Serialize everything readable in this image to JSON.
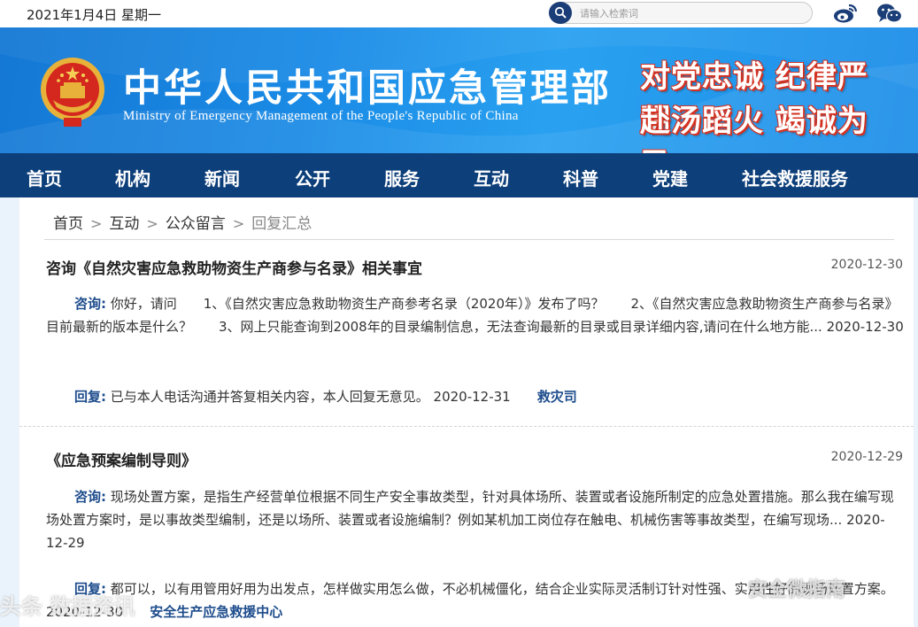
{
  "topbar": {
    "date": "2021年1月4日 星期一",
    "search_placeholder": "请输入检索词",
    "icons": [
      "search-icon",
      "weibo-icon",
      "wechat-icon"
    ]
  },
  "header": {
    "title_cn": "中华人民共和国应急管理部",
    "title_en": "Ministry of Emergency Management of the People's Republic of China",
    "slogan_line1": "对党忠诚 纪律严明",
    "slogan_line2": "赴汤蹈火 竭诚为民"
  },
  "nav": {
    "items": [
      "首页",
      "机构",
      "新闻",
      "公开",
      "服务",
      "互动",
      "科普",
      "党建",
      "社会救援服务"
    ]
  },
  "breadcrumb": {
    "home": "首页",
    "interact": "互动",
    "messages": "公众留言",
    "current": "回复汇总",
    "sep": ">"
  },
  "items": [
    {
      "title": "咨询《自然灾害应急救助物资生产商参与名录》相关事宜",
      "date": "2020-12-30",
      "ask_label": "咨询:",
      "ask_text": " 你好，请问　　1、《自然灾害应急救助物资生产商参考名录（2020年）》发布了吗？　　2、《自然灾害应急救助物资生产商参与名录》目前最新的版本是什么？　　3、网上只能查询到2008年的目录编制信息，无法查询最新的目录或目录详细内容,请问在什么地方能... 2020-12-30",
      "reply_label": "回复:",
      "reply_text": " 已与本人电话沟通并答复相关内容，本人回复无意见。 2020-12-31",
      "reply_dept": "救灾司"
    },
    {
      "title": "《应急预案编制导则》",
      "date": "2020-12-29",
      "ask_label": "咨询:",
      "ask_text": " 现场处置方案，是指生产经营单位根据不同生产安全事故类型，针对具体场所、装置或者设施所制定的应急处置措施。那么我在编写现场处置方案时，是以事故类型编制，还是以场所、装置或者设施编制？例如某机加工岗位存在触电、机械伤害等事故类型，在编写现场... 2020-12-29",
      "reply_label": "回复:",
      "reply_text": " 都可以，以有用管用好用为出发点，怎样做实用怎么做，不必机械僵化，结合企业实际灵活制订针对性强、实用性好的现场处置方案。 2020-12-30",
      "reply_dept": "安全生产应急救援中心"
    }
  ],
  "watermarks": {
    "left": "头条 数据资讯",
    "right": "安全微指南"
  },
  "colors": {
    "nav_bg": "#0d3f7a",
    "banner": "#1a8be6",
    "label_blue": "#1d4c8c",
    "slogan_red": "#d33222"
  }
}
